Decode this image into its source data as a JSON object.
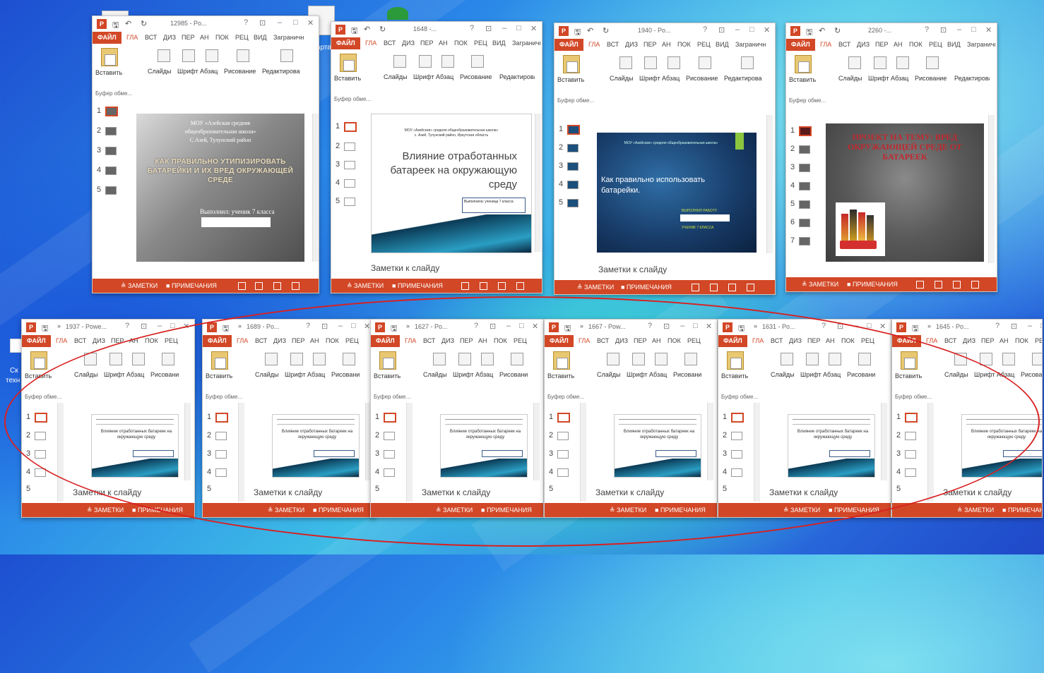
{
  "desktop": {
    "icon_label_1": "арта",
    "icon_label_2": "Ск",
    "icon_label_3": "техн"
  },
  "icons": {
    "app": "powerpoint-icon",
    "save": "save-icon",
    "undo": "undo-icon",
    "redo": "redo-icon",
    "help": "help-icon",
    "restore": "restore-icon",
    "minimize": "minimize-icon",
    "close": "close-icon"
  },
  "colors": {
    "accent": "#d24726",
    "ellipse": "#d82020"
  },
  "tabs_full": [
    "ФАЙЛ",
    "ГЛА",
    "ВСТ",
    "ДИЗ",
    "ПЕР",
    "АН",
    "ПОК",
    "РЕЦ",
    "ВИД",
    "Заграничн"
  ],
  "groups": [
    "Слайды",
    "Шрифт",
    "Абзац",
    "Рисование",
    "Редактирова"
  ],
  "paste": "Вставить",
  "clipboard": "Буфер обме...",
  "notes_label": "Заметки к слайду",
  "status": {
    "notes": "ЗАМЕТКИ",
    "comments": "ПРИМЕЧАНИЯ"
  },
  "windows_top": [
    {
      "title": "12985 - Po...",
      "slide": {
        "line1": "МОУ «Азейская средняя",
        "line2": "общеобразовательная школа»",
        "line3": "С.Азей, Тулунский район",
        "heading": "КАК ПРАВИЛЬНО УТИПИЗИРОВАТЬ БАТАРЕЙКИ И ИХ ВРЕД ОКРУЖАЮЩЕЙ СРЕДЕ",
        "footer": "Выполнил: ученик 7 класса"
      },
      "slide_numbers": [
        "1",
        "2",
        "3",
        "4",
        "5"
      ]
    },
    {
      "title": "1648 -...",
      "slide": {
        "school": "МОУ «Азейская» средняя общеобразовательная школа»",
        "place": "с. Азей, Тулунский район, Иркутская область",
        "heading": "Влияние отработанных батареек на окружающую среду",
        "footer": "Выполнила: ученица 7 класса"
      },
      "slide_numbers": [
        "1",
        "2",
        "3",
        "4",
        "5"
      ]
    },
    {
      "title": "1940 - Po...",
      "slide": {
        "school": "МОУ «Азейская» средняя общеобразовательная школа»",
        "heading": "Как правильно использовать батарейки.",
        "footer1": "ВЫПОЛНИЛ РАБОТУ",
        "footer2": "УЧЕНИК 7 КЛАССА"
      },
      "slide_numbers": [
        "1",
        "2",
        "3",
        "4",
        "5"
      ]
    },
    {
      "title": "2260 -...",
      "slide": {
        "heading": "ПРОЕКТ НА ТЕМУ: ВРЕД ОКРУЖАЮЩЕЙ СРЕДЕ ОТ БАТАРЕЕК"
      },
      "slide_numbers": [
        "1",
        "2",
        "3",
        "4",
        "5",
        "6",
        "7"
      ]
    }
  ],
  "windows_bottom": [
    {
      "title": "1937 - Powe...",
      "slide_heading": "Влияние отработанных батареек на окружающую среду"
    },
    {
      "title": "1689 - Po...",
      "slide_heading": "Влияние отработанных батареек на окружающую среду"
    },
    {
      "title": "1627 - Po...",
      "slide_heading": "Влияние отработанных батареек на окружающую среду"
    },
    {
      "title": "1667 - Pow...",
      "slide_heading": "Влияние отработанных батареек на окружающую среду"
    },
    {
      "title": "1631 - Po...",
      "slide_heading": "Влияние отработанных батареек на окружающую среду"
    },
    {
      "title": "1645 - Po...",
      "slide_heading": "Влияние отработанных батареек на окружающую среду"
    }
  ],
  "bottom_slide_numbers": [
    "1",
    "2",
    "3",
    "4",
    "5"
  ]
}
